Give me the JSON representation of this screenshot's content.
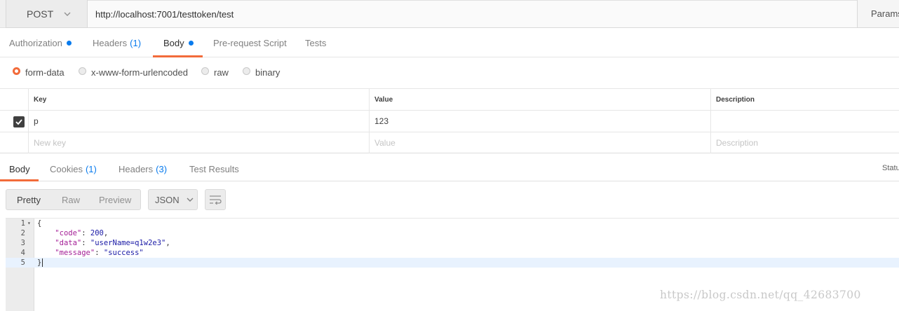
{
  "request": {
    "method": "POST",
    "url": "http://localhost:7001/testtoken/test",
    "params_label": "Params"
  },
  "request_tabs": [
    {
      "label": "Authorization",
      "dot": true
    },
    {
      "label": "Headers",
      "count": "(1)"
    },
    {
      "label": "Body",
      "dot": true,
      "active": true
    },
    {
      "label": "Pre-request Script"
    },
    {
      "label": "Tests"
    }
  ],
  "body_modes": [
    {
      "label": "form-data",
      "selected": true
    },
    {
      "label": "x-www-form-urlencoded",
      "selected": false
    },
    {
      "label": "raw",
      "selected": false
    },
    {
      "label": "binary",
      "selected": false
    }
  ],
  "kv_table": {
    "headers": [
      "Key",
      "Value",
      "Description"
    ],
    "rows": [
      {
        "checked": true,
        "key": "p",
        "value": "123",
        "description": ""
      }
    ],
    "new_row": {
      "key": "New key",
      "value": "Value",
      "description": "Description"
    }
  },
  "response_tabs": [
    {
      "label": "Body",
      "active": true
    },
    {
      "label": "Cookies",
      "count": "(1)"
    },
    {
      "label": "Headers",
      "count": "(3)"
    },
    {
      "label": "Test Results"
    }
  ],
  "status_label": "Status",
  "view_modes": [
    {
      "label": "Pretty",
      "active": true
    },
    {
      "label": "Raw"
    },
    {
      "label": "Preview"
    }
  ],
  "format": "JSON",
  "code_lines": [
    {
      "n": "1",
      "text": "{"
    },
    {
      "n": "2",
      "key": "\"code\"",
      "value": "200",
      "tail": ","
    },
    {
      "n": "3",
      "key": "\"data\"",
      "value": "\"userName=q1w2e3\"",
      "tail": ","
    },
    {
      "n": "4",
      "key": "\"message\"",
      "value": "\"success\"",
      "tail": ""
    },
    {
      "n": "5",
      "text": "}"
    }
  ],
  "watermark": "https://blog.csdn.net/qq_42683700",
  "colors": {
    "accent": "#f26b3a",
    "link": "#097bed"
  }
}
